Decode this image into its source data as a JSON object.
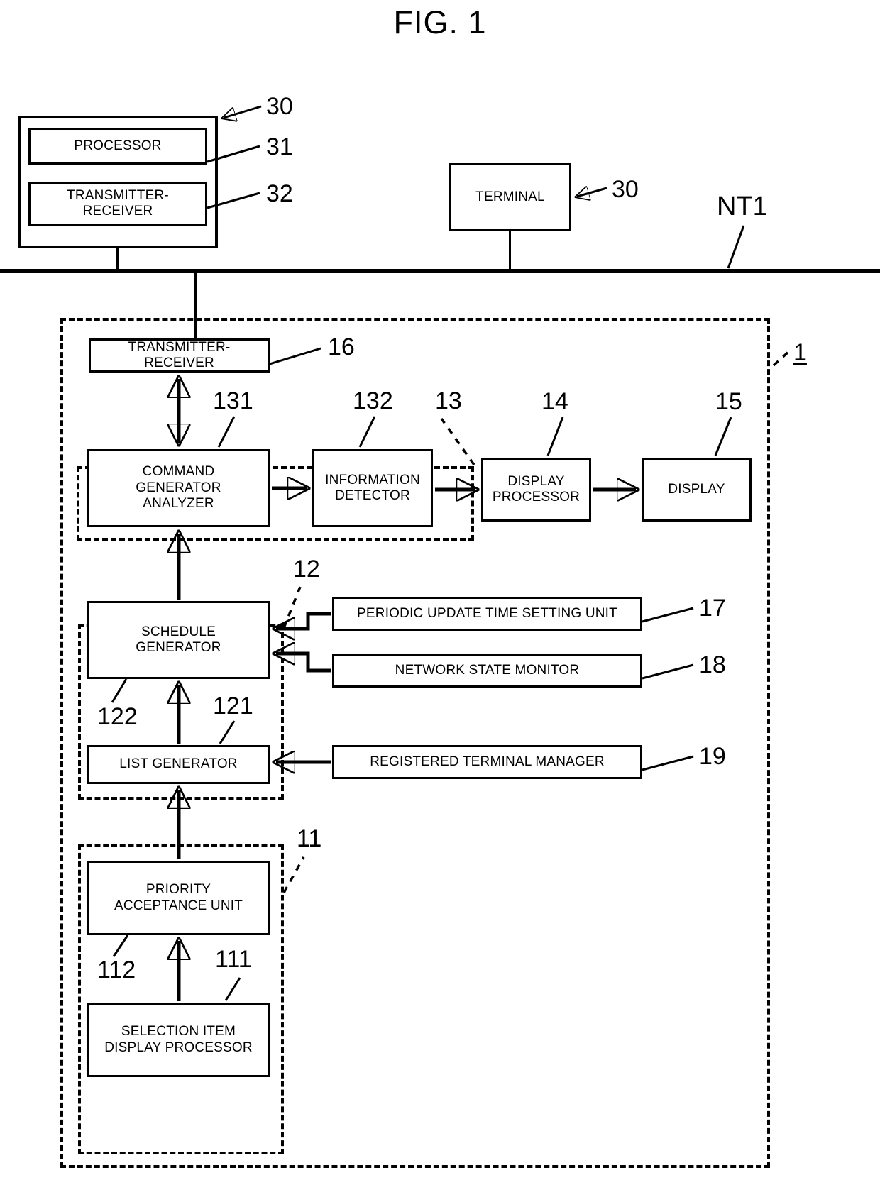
{
  "figure": {
    "title": "FIG. 1",
    "network_label": "NT1",
    "system_ref": "1"
  },
  "terminal_detailed": {
    "outer_ref": "30",
    "blocks": [
      {
        "label": "PROCESSOR",
        "ref": "31"
      },
      {
        "label": "TRANSMITTER-\nRECEIVER",
        "ref": "32"
      }
    ]
  },
  "terminal_simple": {
    "label": "TERMINAL",
    "ref": "30"
  },
  "system": {
    "transmitter_receiver": {
      "label": "TRANSMITTER-\nRECEIVER",
      "ref": "16"
    },
    "group_13": {
      "ref": "13",
      "blocks": [
        {
          "label": "COMMAND\nGENERATOR\nANALYZER",
          "ref": "131"
        },
        {
          "label": "INFORMATION\nDETECTOR",
          "ref": "132"
        }
      ]
    },
    "display_processor": {
      "label": "DISPLAY\nPROCESSOR",
      "ref": "14"
    },
    "display": {
      "label": "DISPLAY",
      "ref": "15"
    },
    "group_12": {
      "ref": "12",
      "blocks": [
        {
          "label": "SCHEDULE\nGENERATOR",
          "ref": "122"
        },
        {
          "label": "LIST GENERATOR",
          "ref": "121"
        }
      ]
    },
    "group_11": {
      "ref": "11",
      "blocks": [
        {
          "label": "PRIORITY\nACCEPTANCE UNIT",
          "ref": "112"
        },
        {
          "label": "SELECTION ITEM\nDISPLAY PROCESSOR",
          "ref": "111"
        }
      ]
    },
    "side_units": [
      {
        "label": "PERIODIC UPDATE TIME SETTING UNIT",
        "ref": "17"
      },
      {
        "label": "NETWORK STATE MONITOR",
        "ref": "18"
      },
      {
        "label": "REGISTERED TERMINAL MANAGER",
        "ref": "19"
      }
    ]
  }
}
